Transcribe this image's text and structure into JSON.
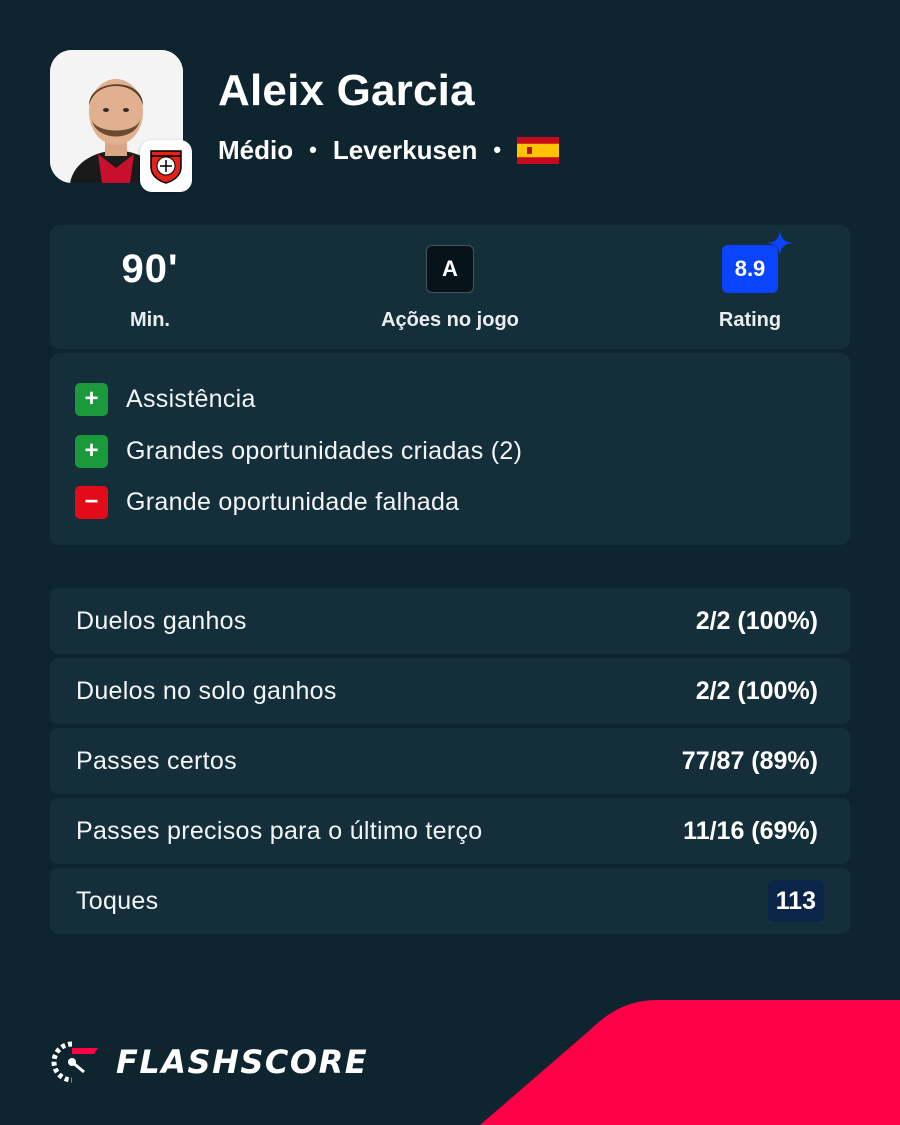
{
  "player": {
    "name": "Aleix Garcia",
    "position": "Médio",
    "team": "Leverkusen",
    "separator": "•",
    "nationality_flag": "spain-flag-icon",
    "club_badge": "bayer-leverkusen-crest-icon"
  },
  "summary": {
    "minutes_value": "90'",
    "minutes_label": "Min.",
    "actions_value": "A",
    "actions_label": "Ações no jogo",
    "rating_value": "8.9",
    "rating_label": "Rating"
  },
  "events": [
    {
      "type": "plus",
      "sign": "+",
      "text": "Assistência"
    },
    {
      "type": "plus",
      "sign": "+",
      "text": "Grandes oportunidades criadas (2)"
    },
    {
      "type": "minus",
      "sign": "−",
      "text": "Grande oportunidade falhada"
    }
  ],
  "stats": [
    {
      "label": "Duelos ganhos",
      "value": "2/2 (100%)"
    },
    {
      "label": "Duelos no solo ganhos",
      "value": "2/2 (100%)"
    },
    {
      "label": "Passes certos",
      "value": "77/87 (89%)"
    },
    {
      "label": "Passes precisos para o último terço",
      "value": "11/16 (69%)"
    },
    {
      "label": "Toques",
      "value": "113"
    }
  ],
  "brand": {
    "name": "FLASHSCORE"
  },
  "colors": {
    "background": "#0e2530",
    "panel": "#152f3a",
    "rating_blue": "#0a44ff",
    "positive_green": "#1a9a3a",
    "negative_red": "#e20b17",
    "brand_accent": "#ff0046"
  }
}
